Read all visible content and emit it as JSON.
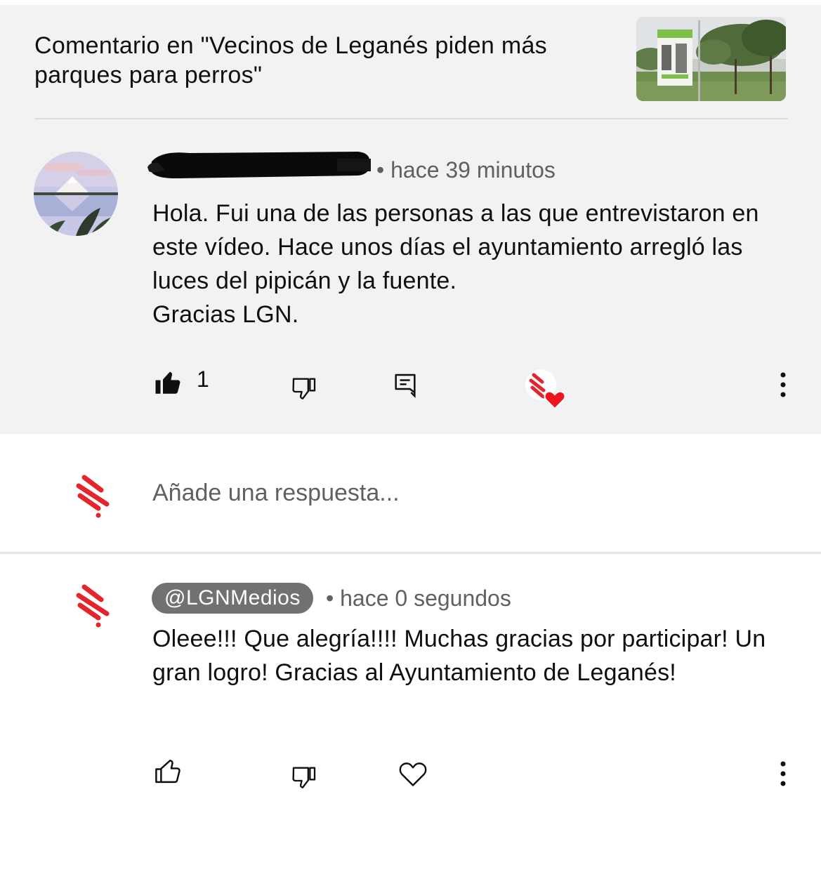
{
  "video": {
    "title": "Comentario en \"Vecinos de Leganés piden más parques para perros\"",
    "thumbnail_icon": "park-thumbnail"
  },
  "comment": {
    "author_redacted": true,
    "meta": "• hace 39 minutos",
    "text": "Hola. Fui una de las personas a las que entrevistaron en este vídeo. Hace unos días el ayuntamiento arregló  las luces del pipicán y la fuente.\nGracias LGN.",
    "like_count": "1",
    "icons": {
      "like": "thumbs-up-filled-icon",
      "dislike": "thumbs-down-outline-icon",
      "reply": "reply-icon",
      "creator_heart": "creator-heart-icon",
      "more": "more-vertical-icon"
    }
  },
  "reply_input": {
    "placeholder": "Añade una respuesta..."
  },
  "reply": {
    "handle": "@LGNMedios",
    "meta": "• hace 0 segundos",
    "text": "Oleee!!! Que alegría!!!! Muchas gracias por participar! Un gran logro! Gracias al Ayuntamiento de Leganés!",
    "icons": {
      "like": "thumbs-up-outline-icon",
      "dislike": "thumbs-down-outline-icon",
      "heart": "heart-outline-icon",
      "more": "more-vertical-icon"
    }
  },
  "colors": {
    "brand_red": "#e4252b",
    "heart_red": "#f0141e",
    "secondary_text": "#606060",
    "parent_background": "#f2f2f2"
  }
}
